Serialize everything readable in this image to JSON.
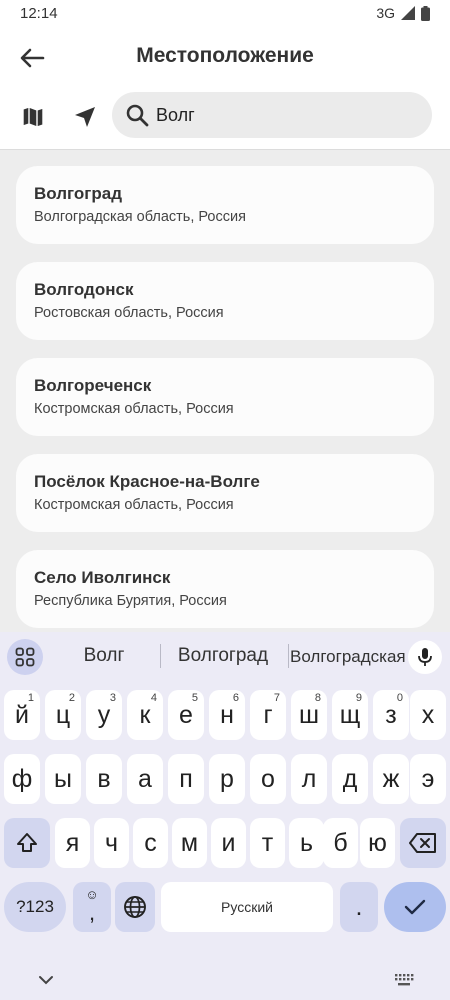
{
  "status_bar": {
    "time": "12:14",
    "network": "3G",
    "signal_icon": "signal-icon",
    "battery_icon": "battery-icon"
  },
  "header": {
    "title": "Местоположение",
    "back_icon": "arrow-left-icon"
  },
  "search": {
    "value": "Волг",
    "placeholder": "",
    "map_icon": "map-icon",
    "locate_icon": "navigation-arrow-icon",
    "search_icon": "search-icon"
  },
  "results": [
    {
      "title": "Волгоград",
      "subtitle": "Волгоградская область, Россия"
    },
    {
      "title": "Волгодонск",
      "subtitle": "Ростовская область, Россия"
    },
    {
      "title": "Волгореченск",
      "subtitle": "Костромская область, Россия"
    },
    {
      "title": "Посёлок Красное-на-Волге",
      "subtitle": "Костромская область, Россия"
    },
    {
      "title": "Село Иволгинск",
      "subtitle": "Республика Бурятия, Россия"
    }
  ],
  "keyboard": {
    "suggestions": [
      "Волг",
      "Волгоград",
      "Волгоградская"
    ],
    "row1": [
      {
        "char": "й",
        "hint": "1"
      },
      {
        "char": "ц",
        "hint": "2"
      },
      {
        "char": "у",
        "hint": "3"
      },
      {
        "char": "к",
        "hint": "4"
      },
      {
        "char": "е",
        "hint": "5"
      },
      {
        "char": "н",
        "hint": "6"
      },
      {
        "char": "г",
        "hint": "7"
      },
      {
        "char": "ш",
        "hint": "8"
      },
      {
        "char": "щ",
        "hint": "9"
      },
      {
        "char": "з",
        "hint": "0"
      },
      {
        "char": "х",
        "hint": ""
      }
    ],
    "row2": [
      "ф",
      "ы",
      "в",
      "а",
      "п",
      "р",
      "о",
      "л",
      "д",
      "ж",
      "э"
    ],
    "row3": [
      "я",
      "ч",
      "с",
      "м",
      "и",
      "т",
      "ь",
      "б",
      "ю"
    ],
    "symbols_label": "?123",
    "emoji_comma": ",",
    "space_label": "Русский",
    "period": ".",
    "colors": {
      "background": "#ecebf6",
      "function_key": "#d2d6ef",
      "enter_key": "#aebfee"
    }
  }
}
